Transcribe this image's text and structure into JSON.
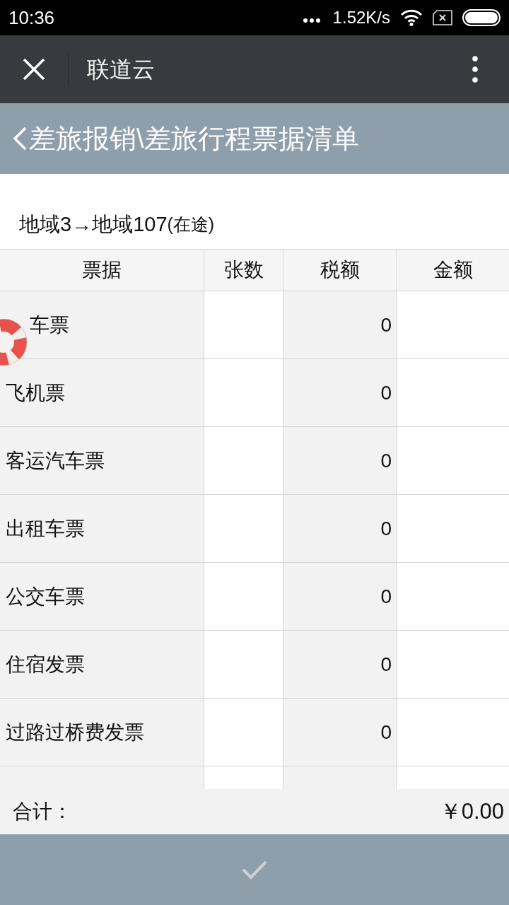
{
  "status_bar": {
    "time": "10:36",
    "speed": "1.52K/s"
  },
  "app_bar": {
    "title": "联道云"
  },
  "page_header": {
    "title": "差旅报销\\差旅行程票据清单"
  },
  "trip": {
    "route": "地域3→地域107",
    "status": "(在途)"
  },
  "table": {
    "columns": [
      "票据",
      "张数",
      "税额",
      "金额"
    ],
    "rows": [
      {
        "name": "车票",
        "tax": "0"
      },
      {
        "name": "飞机票",
        "tax": "0"
      },
      {
        "name": "客运汽车票",
        "tax": "0"
      },
      {
        "name": "出租车票",
        "tax": "0"
      },
      {
        "name": "公交车票",
        "tax": "0"
      },
      {
        "name": "住宿发票",
        "tax": "0"
      },
      {
        "name": "过路过桥费发票",
        "tax": "0"
      }
    ]
  },
  "total": {
    "label": "合计：",
    "value": "￥0.00"
  }
}
